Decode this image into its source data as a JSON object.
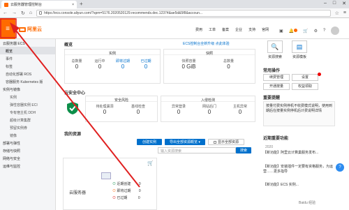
{
  "browser": {
    "tab_title": "云服务器管理控制台",
    "tab_close": "×",
    "new_tab": "+",
    "url": "https://ecs.console.aliyun.com/?spm=5176.2020520129.recommends.dec.12374&ae5d&5f8&accoun..."
  },
  "header": {
    "menu_icon": "≡",
    "logo_text": "阿里云",
    "nav": [
      "费用",
      "工单",
      "备案",
      "企业",
      "支持",
      "官网"
    ],
    "icons": [
      "▣",
      "🔔",
      "🛒",
      "⚙",
      "?"
    ]
  },
  "sidebar": {
    "title": "云服务器 ECS",
    "items": [
      {
        "label": "概览",
        "active": true,
        "type": "item"
      },
      {
        "label": "事件",
        "type": "item"
      },
      {
        "label": "标签",
        "type": "item"
      },
      {
        "label": "自动化部署 ROS",
        "type": "item"
      },
      {
        "label": "容器服务 Kubernetes 版",
        "type": "item"
      },
      {
        "label": "实例与镜像",
        "type": "group"
      },
      {
        "label": "实例",
        "type": "sub"
      },
      {
        "label": "弹性容器实例 ECI",
        "type": "sub"
      },
      {
        "label": "专有宿主机 DDH",
        "type": "sub"
      },
      {
        "label": "超级计算集群",
        "type": "sub"
      },
      {
        "label": "预留实例券",
        "type": "sub"
      },
      {
        "label": "镜像",
        "type": "sub"
      },
      {
        "label": "部署与弹性",
        "type": "group"
      },
      {
        "label": "存储与快照",
        "type": "group"
      },
      {
        "label": "网络与安全",
        "type": "group"
      },
      {
        "label": "运维与监控",
        "type": "group"
      }
    ]
  },
  "overview": {
    "title": "概览",
    "tip": "ECS控制台全新升级 点此体验",
    "instances": {
      "title": "实例",
      "stats": [
        {
          "num": "0",
          "label": "总数量"
        },
        {
          "num": "0",
          "label": "运行中"
        },
        {
          "num": "0",
          "label": "即将过期"
        },
        {
          "num": "0",
          "label": "已过期"
        }
      ]
    },
    "snapshot": {
      "title": "快照",
      "stats": [
        {
          "num": "0 GiB",
          "label": "快照容量"
        },
        {
          "num": "0",
          "label": "总数量"
        }
      ]
    }
  },
  "security": {
    "title": "云安全中心",
    "risk": {
      "title": "安全风险",
      "stats": [
        {
          "num": "0",
          "label": "待处理漏洞"
        },
        {
          "num": "0",
          "label": "基线检查"
        }
      ]
    },
    "intrusion": {
      "title": "入侵检测",
      "stats": [
        {
          "num": "0",
          "label": "异常登录"
        },
        {
          "num": "0",
          "label": "网站后门"
        },
        {
          "num": "0",
          "label": "主机异常"
        }
      ]
    }
  },
  "resources": {
    "title": "我的资源",
    "create_btn": "创建实例",
    "export_btn": "导出全部资源概览 ▾",
    "show_btn": "显示全部资源",
    "search_placeholder": "输入资源搜索",
    "search_btn": "搜索",
    "product": {
      "name": "云服务器",
      "rows": [
        {
          "label": "近期创建",
          "value": "0"
        },
        {
          "label": "即将过期",
          "value": "0"
        },
        {
          "label": "已过期",
          "value": "0"
        }
      ]
    }
  },
  "quick": {
    "items": [
      {
        "label": "资源搜索",
        "icon": "🔍"
      },
      {
        "label": "资源模板",
        "icon": "▤"
      }
    ],
    "common_title": "常用操作",
    "common": [
      "续费管理",
      "设置",
      "开通按量",
      "权益领取"
    ],
    "announce_title": "重要提醒",
    "announce_text": "按量付费实例停机不收费模式说明，使用到期后在按量实例停机后计费说明详情",
    "recent_title": "近期重要功能",
    "year": "2020",
    "news": [
      "【新功能】阿里云计算巢服务发布...",
      "【新功能】安装插件一定要有资格服务，为运营……更多指导",
      "【新功能】ECS 实例..."
    ]
  },
  "watermark": "Baidu 经验",
  "help_icon": "?"
}
